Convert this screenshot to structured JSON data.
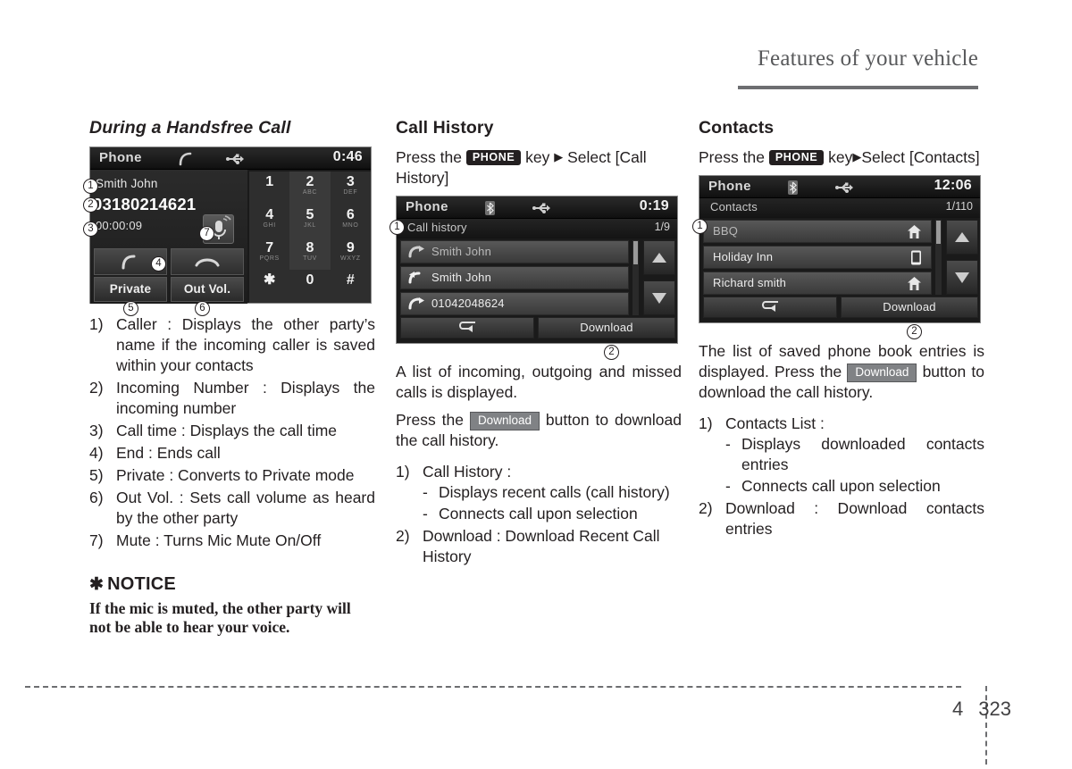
{
  "header": {
    "title": "Features of your vehicle"
  },
  "footer": {
    "chapter": "4",
    "page": "323"
  },
  "left_column": {
    "title": "During a Handsfree Call",
    "screenshot": {
      "status": {
        "title": "Phone",
        "icon1": "handset-icon",
        "icon2": "usb-icon",
        "clock": "0:46"
      },
      "caller_name": "Smith John",
      "caller_number": "03180214621",
      "call_time": "00:00:09",
      "mute_icon": "mic-mute-icon",
      "call_button_icon": "handset-icon",
      "end_button_icon": "end-call-icon",
      "private_label": "Private",
      "out_vol_label": "Out Vol.",
      "keypad": [
        {
          "digit": "1",
          "letters": ""
        },
        {
          "digit": "2",
          "letters": "ABC"
        },
        {
          "digit": "3",
          "letters": "DEF"
        },
        {
          "digit": "4",
          "letters": "GHI"
        },
        {
          "digit": "5",
          "letters": "JKL"
        },
        {
          "digit": "6",
          "letters": "MNO"
        },
        {
          "digit": "7",
          "letters": "PQRS"
        },
        {
          "digit": "8",
          "letters": "TUV"
        },
        {
          "digit": "9",
          "letters": "WXYZ"
        },
        {
          "digit": "✱",
          "letters": ""
        },
        {
          "digit": "0",
          "letters": ""
        },
        {
          "digit": "#",
          "letters": ""
        }
      ],
      "callouts": [
        "1",
        "2",
        "3",
        "4",
        "5",
        "6",
        "7"
      ]
    },
    "items": [
      {
        "mk": "1)",
        "text": "Caller : Displays the other party’s name if the incoming caller is saved within your contacts"
      },
      {
        "mk": "2)",
        "text": "Incoming Number : Displays the incoming number"
      },
      {
        "mk": "3)",
        "text": "Call time : Displays the call time"
      },
      {
        "mk": "4)",
        "text": "End : Ends call"
      },
      {
        "mk": "5)",
        "text": "Private : Converts to Private mode"
      },
      {
        "mk": "6)",
        "text": "Out Vol. : Sets call volume as heard by the other party"
      },
      {
        "mk": "7)",
        "text": "Mute : Turns Mic Mute On/Off"
      }
    ],
    "notice": {
      "star": "✱",
      "heading": "NOTICE",
      "body": "If the mic is muted, the other party will not be able to hear your voice."
    }
  },
  "middle_column": {
    "title": "Call History",
    "intro_pre": "Press the",
    "key_badge": "PHONE",
    "intro_mid": "key",
    "arrow": "▶",
    "intro_post": "Select [Call History]",
    "screenshot": {
      "status": {
        "title": "Phone",
        "icon1": "bluetooth-icon",
        "icon2": "usb-icon",
        "clock": "0:19"
      },
      "sub_label": "Call history",
      "count": "1/9",
      "rows": [
        {
          "icon": "outgoing-call-icon",
          "text": "Smith John"
        },
        {
          "icon": "incoming-call-icon",
          "text": "Smith John"
        },
        {
          "icon": "outgoing-call-icon",
          "text": "01042048624"
        }
      ],
      "back_icon": "back-arrow-icon",
      "download_label": "Download",
      "scroll_up_icon": "triangle-up-icon",
      "scroll_down_icon": "triangle-down-icon",
      "callouts": [
        "1",
        "2"
      ]
    },
    "body1": "A list of incoming, outgoing and missed calls is displayed.",
    "body2_pre": "Press the",
    "body2_badge": "Download",
    "body2_post": "button to download the call history.",
    "items": [
      {
        "mk": "1)",
        "text": "Call History :",
        "subs": [
          "Displays recent calls (call history)",
          "Connects call upon selection"
        ]
      },
      {
        "mk": "2)",
        "text": "Download : Download Recent Call History",
        "subs": []
      }
    ]
  },
  "right_column": {
    "title": "Contacts",
    "intro_pre": "Press the",
    "key_badge": "PHONE",
    "intro_mid": "key",
    "arrow": "▶",
    "intro_post": "Select [Contacts]",
    "screenshot": {
      "status": {
        "title": "Phone",
        "icon1": "bluetooth-icon",
        "icon2": "usb-icon",
        "clock": "12:06"
      },
      "sub_label": "Contacts",
      "count": "1/110",
      "rows": [
        {
          "icon": "home-icon",
          "text": "BBQ"
        },
        {
          "icon": "mobile-icon",
          "text": "Holiday Inn"
        },
        {
          "icon": "home-icon",
          "text": "Richard smith"
        }
      ],
      "back_icon": "back-arrow-icon",
      "download_label": "Download",
      "scroll_up_icon": "triangle-up-icon",
      "scroll_down_icon": "triangle-down-icon",
      "callouts": [
        "1",
        "2"
      ]
    },
    "body1_pre": "The list of saved phone book entries is displayed. Press the",
    "body1_badge": "Download",
    "body1_post": "button to download the call history.",
    "items": [
      {
        "mk": "1)",
        "text": "Contacts List :",
        "subs": [
          "Displays downloaded contacts entries",
          "Connects call upon selection"
        ]
      },
      {
        "mk": "2)",
        "text": "Download : Download contacts entries",
        "subs": []
      }
    ]
  },
  "colors": {
    "header_gray": "#6d6e71",
    "text": "#231f20",
    "badge_black": "#231f20",
    "badge_gray": "#808285"
  }
}
